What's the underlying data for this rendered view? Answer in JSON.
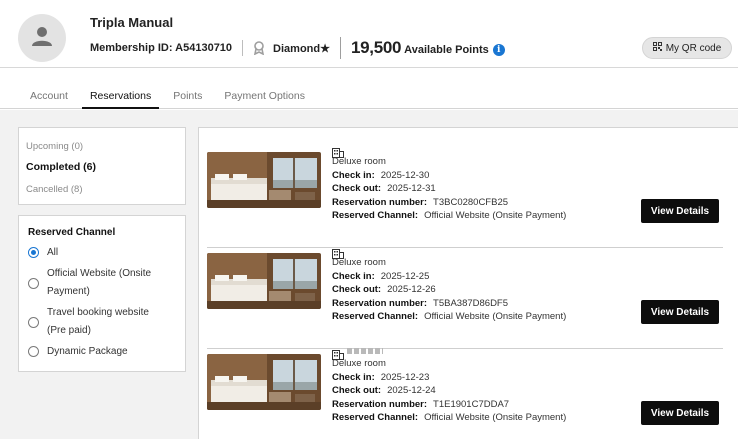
{
  "profile": {
    "name": "Tripla Manual",
    "membership_id": "Membership ID: A54130710",
    "tier": "Diamond★",
    "points": "19,500",
    "points_label": "Available Points",
    "info_glyph": "i",
    "qr_label": "My QR code",
    "icons": {
      "avatar": "person-icon",
      "tier": "medal-icon",
      "info": "info-icon",
      "qr": "qr-code-icon"
    },
    "colors": {
      "info": "#1976d2",
      "button": "#e6e6e6"
    }
  },
  "tabs": [
    {
      "label": "Account",
      "active": false
    },
    {
      "label": "Reservations",
      "active": true
    },
    {
      "label": "Points",
      "active": false
    },
    {
      "label": "Payment Options",
      "active": false
    }
  ],
  "status_filter": [
    {
      "label": "Upcoming (0)",
      "selected": false
    },
    {
      "label": "Completed (6)",
      "selected": true
    },
    {
      "label": "Cancelled (8)",
      "selected": false
    }
  ],
  "channel_filter": {
    "title": "Reserved Channel",
    "options": [
      {
        "label": "All",
        "checked": true
      },
      {
        "label": "Official Website (Onsite Payment)",
        "checked": false
      },
      {
        "label": "Travel booking website (Pre paid)",
        "checked": false
      },
      {
        "label": "Dynamic Package",
        "checked": false
      }
    ]
  },
  "reservations": [
    {
      "room": "Deluxe room",
      "check_in_label": "Check in:",
      "check_in": "2025-12-30",
      "check_out_label": "Check out:",
      "check_out": "2025-12-31",
      "number_label": "Reservation number:",
      "number": "T3BC0280CFB25",
      "channel_label": "Reserved Channel:",
      "channel": "Official Website (Onsite Payment)",
      "button": "View Details",
      "icon": "building-icon"
    },
    {
      "room": "Deluxe room",
      "check_in_label": "Check in:",
      "check_in": "2025-12-25",
      "check_out_label": "Check out:",
      "check_out": "2025-12-26",
      "number_label": "Reservation number:",
      "number": "T5BA387D86DF5",
      "channel_label": "Reserved Channel:",
      "channel": "Official Website (Onsite Payment)",
      "button": "View Details",
      "icon": "building-icon"
    },
    {
      "room": "Deluxe room",
      "check_in_label": "Check in:",
      "check_in": "2025-12-23",
      "check_out_label": "Check out:",
      "check_out": "2025-12-24",
      "number_label": "Reservation number:",
      "number": "T1E1901C7DDA7",
      "channel_label": "Reserved Channel:",
      "channel": "Official Website (Onsite Payment)",
      "button": "View Details",
      "icon": "building-icon"
    }
  ]
}
